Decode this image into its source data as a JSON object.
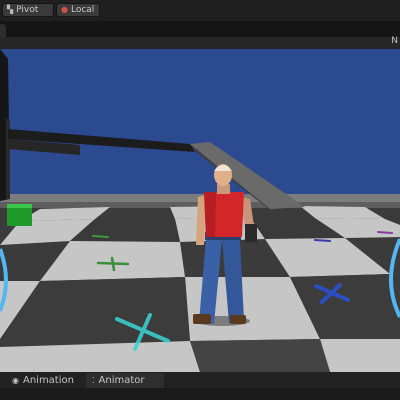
{
  "toolbar": {
    "pivot_label": "Pivot",
    "pivot_icon": "pivot-icon",
    "local_label": "Local",
    "local_icon": "local-globe-icon"
  },
  "scene_view": {
    "sky_color": "#2b4a90",
    "floor_light": "#c6c6c6",
    "floor_dark": "#3b3b3b",
    "character_shirt_color": "#d2262a",
    "character_jeans_color": "#3a60a6",
    "overflow_glyph": "N"
  },
  "bottom_tabs": [
    {
      "label": "Animation",
      "icon": "animation-icon",
      "active": false
    },
    {
      "label": "Animator",
      "icon": "animator-icon",
      "active": true
    }
  ]
}
